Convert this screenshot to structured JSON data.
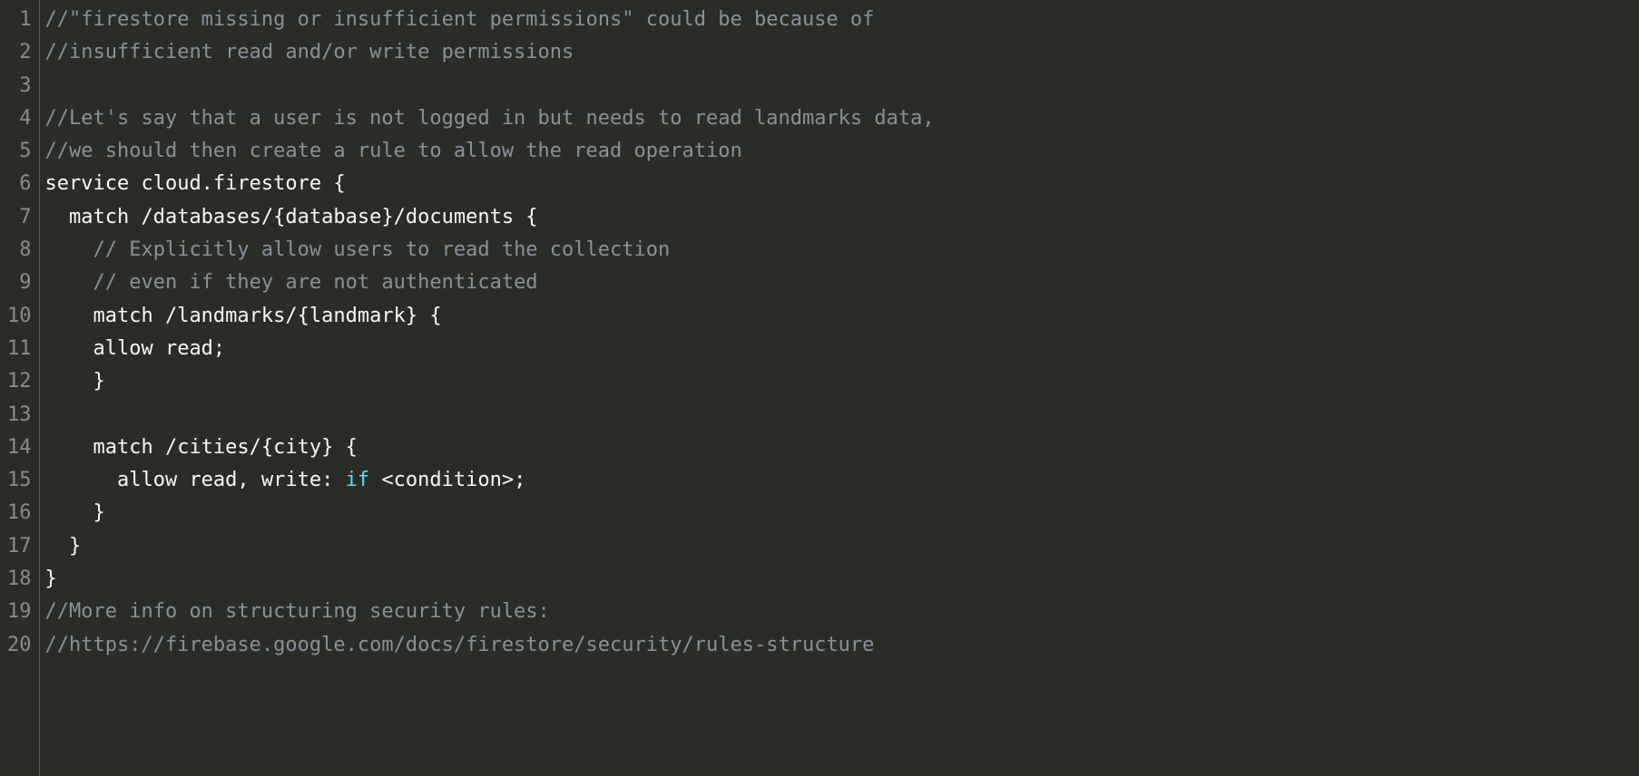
{
  "editor": {
    "lines": [
      {
        "num": "1",
        "tokens": [
          {
            "cls": "tok-comment",
            "text": "//\"firestore missing or insufficient permissions\" could be because of"
          }
        ]
      },
      {
        "num": "2",
        "tokens": [
          {
            "cls": "tok-comment",
            "text": "//insufficient read and/or write permissions"
          }
        ]
      },
      {
        "num": "3",
        "tokens": []
      },
      {
        "num": "4",
        "tokens": [
          {
            "cls": "tok-comment",
            "text": "//Let's say that a user is not logged in but needs to read landmarks data,"
          }
        ]
      },
      {
        "num": "5",
        "tokens": [
          {
            "cls": "tok-comment",
            "text": "//we should then create a rule to allow the read operation"
          }
        ]
      },
      {
        "num": "6",
        "tokens": [
          {
            "cls": "tok-default",
            "text": "service cloud.firestore {"
          }
        ]
      },
      {
        "num": "7",
        "tokens": [
          {
            "cls": "tok-default",
            "text": "  match /databases/{database}/documents {"
          }
        ]
      },
      {
        "num": "8",
        "tokens": [
          {
            "cls": "tok-default",
            "text": "    "
          },
          {
            "cls": "tok-comment",
            "text": "// Explicitly allow users to read the collection"
          }
        ]
      },
      {
        "num": "9",
        "tokens": [
          {
            "cls": "tok-default",
            "text": "    "
          },
          {
            "cls": "tok-comment",
            "text": "// even if they are not authenticated"
          }
        ]
      },
      {
        "num": "10",
        "tokens": [
          {
            "cls": "tok-default",
            "text": "    match /landmarks/{landmark} {"
          }
        ]
      },
      {
        "num": "11",
        "tokens": [
          {
            "cls": "tok-default",
            "text": "    allow read;"
          }
        ]
      },
      {
        "num": "12",
        "tokens": [
          {
            "cls": "tok-default",
            "text": "    }"
          }
        ]
      },
      {
        "num": "13",
        "tokens": []
      },
      {
        "num": "14",
        "tokens": [
          {
            "cls": "tok-default",
            "text": "    match /cities/{city} {"
          }
        ]
      },
      {
        "num": "15",
        "tokens": [
          {
            "cls": "tok-default",
            "text": "      allow read, write: "
          },
          {
            "cls": "tok-keyword",
            "text": "if"
          },
          {
            "cls": "tok-default",
            "text": " "
          },
          {
            "cls": "tok-punct",
            "text": "<"
          },
          {
            "cls": "tok-default",
            "text": "condition"
          },
          {
            "cls": "tok-punct",
            "text": ">"
          },
          {
            "cls": "tok-default",
            "text": ";"
          }
        ]
      },
      {
        "num": "16",
        "tokens": [
          {
            "cls": "tok-default",
            "text": "    }"
          }
        ]
      },
      {
        "num": "17",
        "tokens": [
          {
            "cls": "tok-default",
            "text": "  }"
          }
        ]
      },
      {
        "num": "18",
        "tokens": [
          {
            "cls": "tok-default",
            "text": "}"
          }
        ]
      },
      {
        "num": "19",
        "tokens": [
          {
            "cls": "tok-comment",
            "text": "//More info on structuring security rules:"
          }
        ]
      },
      {
        "num": "20",
        "tokens": [
          {
            "cls": "tok-comment",
            "text": "//https://firebase.google.com/docs/firestore/security/rules-structure"
          }
        ]
      }
    ]
  }
}
